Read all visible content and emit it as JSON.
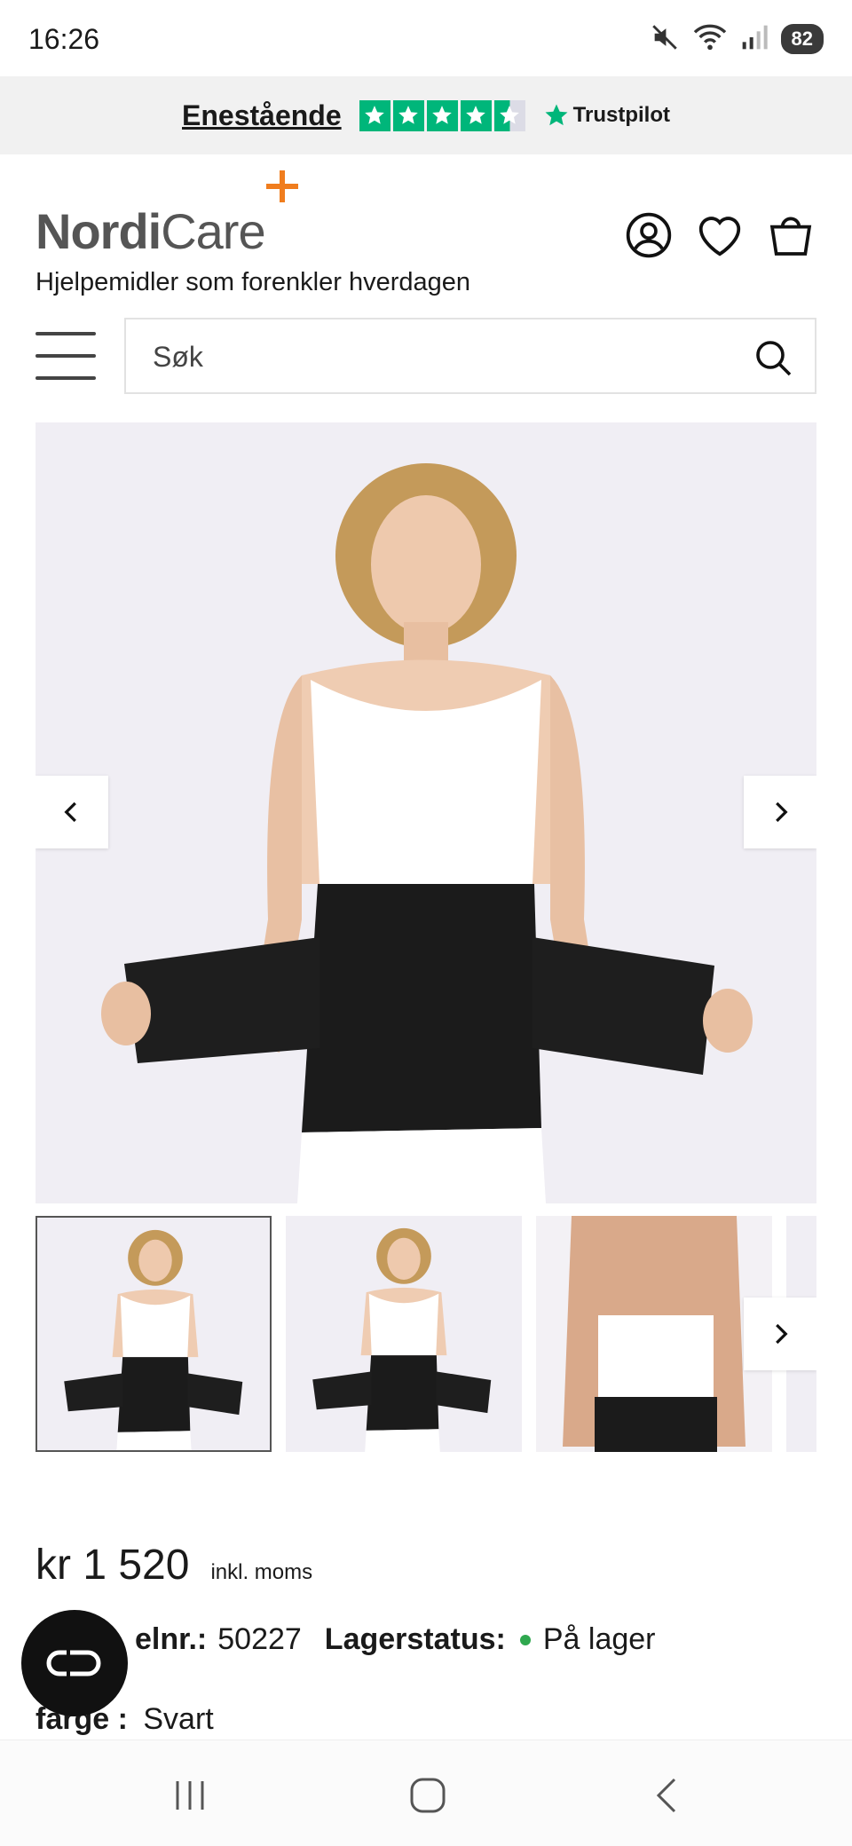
{
  "status_bar": {
    "time": "16:26",
    "battery": "82",
    "icons": [
      "mute-icon",
      "wifi-icon",
      "signal-icon",
      "battery-icon"
    ]
  },
  "trustpilot": {
    "rating_text": "Enestående",
    "stars": 4.5,
    "brand": "Trustpilot",
    "color": "#00b67a"
  },
  "header": {
    "logo_text_bold": "Nordi",
    "logo_text_light": "Care",
    "tagline": "Hjelpemidler som forenkler hverdagen",
    "accent_color": "#f07d1e",
    "icons": [
      "account-icon",
      "wishlist-heart-icon",
      "cart-bag-icon"
    ]
  },
  "search": {
    "placeholder": "Søk"
  },
  "gallery": {
    "thumbnail_count": 4,
    "active_index": 0
  },
  "product": {
    "price": "kr 1 520",
    "vat_note": "inkl. moms",
    "article_label": "elnr.:",
    "article_number": "50227",
    "stock_label": "Lagerstatus:",
    "stock_value": "På lager",
    "color_label": "farge :",
    "color_value": "Svart"
  }
}
